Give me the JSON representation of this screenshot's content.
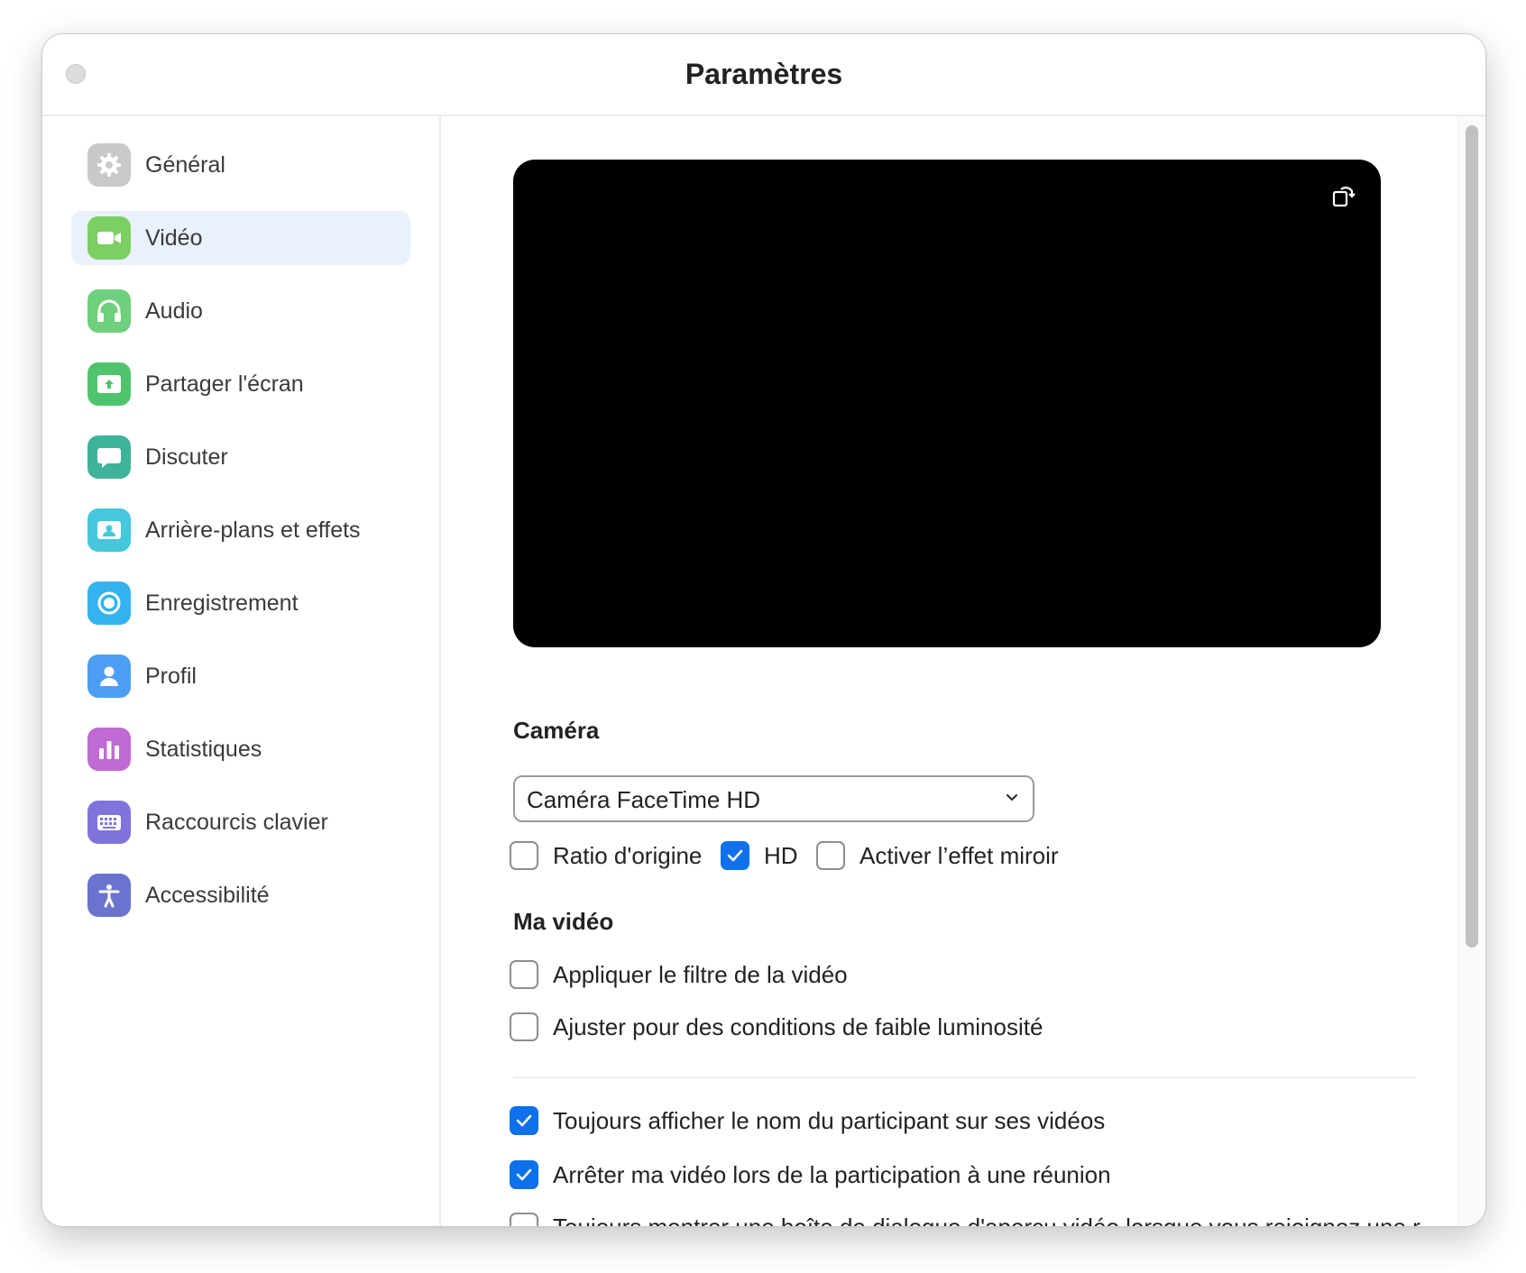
{
  "window": {
    "title": "Paramètres"
  },
  "sidebar": {
    "items": [
      {
        "label": "Général",
        "icon": "gear-icon",
        "color": "#c4c4c4",
        "active": false
      },
      {
        "label": "Vidéo",
        "icon": "video-camera-icon",
        "color": "#7bcf63",
        "active": true
      },
      {
        "label": "Audio",
        "icon": "headphones-icon",
        "color": "#6ecf7c",
        "active": false
      },
      {
        "label": "Partager l'écran",
        "icon": "share-screen-icon",
        "color": "#4fc46c",
        "active": false
      },
      {
        "label": "Discuter",
        "icon": "chat-bubble-icon",
        "color": "#3fb29c",
        "active": false
      },
      {
        "label": "Arrière-plans et effets",
        "icon": "background-person-icon",
        "color": "#45c7dc",
        "active": false
      },
      {
        "label": "Enregistrement",
        "icon": "record-icon",
        "color": "#34b3ee",
        "active": false
      },
      {
        "label": "Profil",
        "icon": "profile-icon",
        "color": "#4b9ef3",
        "active": false
      },
      {
        "label": "Statistiques",
        "icon": "bar-chart-icon",
        "color": "#c06ad4",
        "active": false
      },
      {
        "label": "Raccourcis clavier",
        "icon": "keyboard-icon",
        "color": "#7f74dc",
        "active": false
      },
      {
        "label": "Accessibilité",
        "icon": "accessibility-icon",
        "color": "#6b73cf",
        "active": false
      }
    ]
  },
  "main": {
    "camera_section_title": "Caméra",
    "camera_select": {
      "value": "Caméra FaceTime HD"
    },
    "camera_options": [
      {
        "label": "Ratio d'origine",
        "checked": false
      },
      {
        "label": "HD",
        "checked": true
      },
      {
        "label": "Activer l’effet miroir",
        "checked": false
      }
    ],
    "my_video_section_title": "Ma vidéo",
    "my_video_options": [
      {
        "label": "Appliquer le filtre de la vidéo",
        "checked": false
      },
      {
        "label": "Ajuster pour des conditions de faible luminosité",
        "checked": false
      }
    ],
    "more_options": [
      {
        "label": "Toujours afficher le nom du participant sur ses vidéos",
        "checked": true
      },
      {
        "label": "Arrêter ma vidéo lors de la participation à une réunion",
        "checked": true
      },
      {
        "label": "Toujours montrer une boîte de dialogue d'aperçu vidéo lorsque vous rejoignez une r",
        "checked": false
      }
    ]
  },
  "colors": {
    "accent": "#0e71eb",
    "active_nav_bg": "#e8f1fc"
  }
}
